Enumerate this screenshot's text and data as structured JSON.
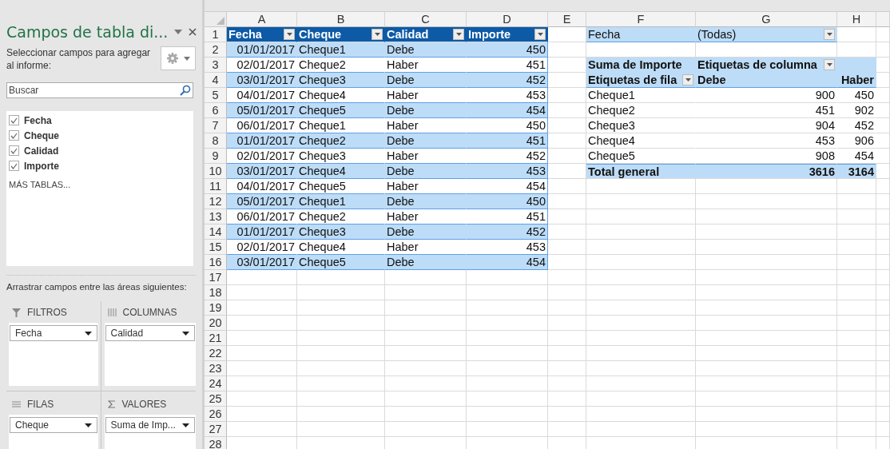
{
  "field_pane": {
    "title": "Campos de tabla di...",
    "subtitle": "Seleccionar campos para agregar al informe:",
    "search": {
      "placeholder": "Buscar"
    },
    "fields": [
      {
        "label": "Fecha",
        "checked": true
      },
      {
        "label": "Cheque",
        "checked": true
      },
      {
        "label": "Calidad",
        "checked": true
      },
      {
        "label": "Importe",
        "checked": true
      }
    ],
    "more_tables": "MÁS TABLAS...",
    "drag_hint": "Arrastrar campos entre las áreas siguientes:",
    "areas": [
      {
        "kind": "filter",
        "label": "FILTROS",
        "items": [
          "Fecha"
        ]
      },
      {
        "kind": "columns",
        "label": "COLUMNAS",
        "items": [
          "Calidad"
        ]
      },
      {
        "kind": "rows",
        "label": "FILAS",
        "items": [
          "Cheque"
        ]
      },
      {
        "kind": "values",
        "label": "VALORES",
        "items": [
          "Suma de Imp..."
        ]
      }
    ]
  },
  "sheet": {
    "column_headers": [
      "A",
      "B",
      "C",
      "D",
      "E",
      "F",
      "G",
      "H"
    ],
    "row_numbers": [
      "1",
      "2",
      "3",
      "4",
      "5",
      "6",
      "7",
      "8",
      "9",
      "10",
      "11",
      "12",
      "13",
      "14",
      "15",
      "16",
      "17",
      "18",
      "19",
      "20",
      "21",
      "22",
      "23",
      "24",
      "25",
      "26",
      "27",
      "28"
    ],
    "table": {
      "columns": [
        "Fecha",
        "Cheque",
        "Calidad",
        "Importe"
      ],
      "rows": [
        [
          "01/01/2017",
          "Cheque1",
          "Debe",
          "450"
        ],
        [
          "02/01/2017",
          "Cheque2",
          "Haber",
          "451"
        ],
        [
          "03/01/2017",
          "Cheque3",
          "Debe",
          "452"
        ],
        [
          "04/01/2017",
          "Cheque4",
          "Haber",
          "453"
        ],
        [
          "05/01/2017",
          "Cheque5",
          "Debe",
          "454"
        ],
        [
          "06/01/2017",
          "Cheque1",
          "Haber",
          "450"
        ],
        [
          "01/01/2017",
          "Cheque2",
          "Debe",
          "451"
        ],
        [
          "02/01/2017",
          "Cheque3",
          "Haber",
          "452"
        ],
        [
          "03/01/2017",
          "Cheque4",
          "Debe",
          "453"
        ],
        [
          "04/01/2017",
          "Cheque5",
          "Haber",
          "454"
        ],
        [
          "05/01/2017",
          "Cheque1",
          "Debe",
          "450"
        ],
        [
          "06/01/2017",
          "Cheque2",
          "Haber",
          "451"
        ],
        [
          "01/01/2017",
          "Cheque3",
          "Debe",
          "452"
        ],
        [
          "02/01/2017",
          "Cheque4",
          "Haber",
          "453"
        ],
        [
          "03/01/2017",
          "Cheque5",
          "Debe",
          "454"
        ]
      ]
    },
    "pivot": {
      "filter_label": "Fecha",
      "filter_value": "(Todas)",
      "value_label": "Suma de Importe",
      "column_label": "Etiquetas de columna",
      "row_label": "Etiquetas de fila",
      "column_items": [
        "Debe",
        "Haber"
      ],
      "rows": [
        [
          "Cheque1",
          "900",
          "450"
        ],
        [
          "Cheque2",
          "451",
          "902"
        ],
        [
          "Cheque3",
          "904",
          "452"
        ],
        [
          "Cheque4",
          "453",
          "906"
        ],
        [
          "Cheque5",
          "908",
          "454"
        ]
      ],
      "total": [
        "Total general",
        "3616",
        "3164"
      ]
    }
  }
}
